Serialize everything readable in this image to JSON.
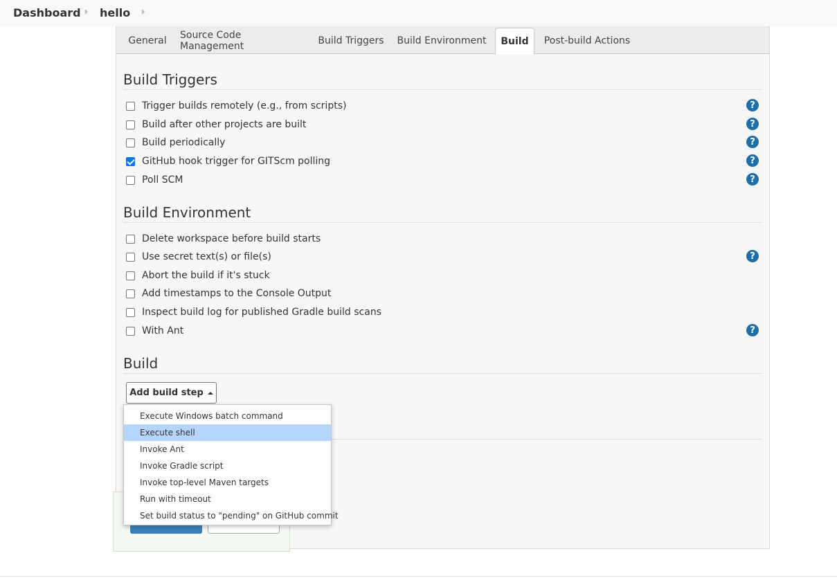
{
  "breadcrumb": {
    "items": [
      "Dashboard",
      "hello"
    ]
  },
  "tabs": [
    "General",
    "Source Code Management",
    "Build Triggers",
    "Build Environment",
    "Build",
    "Post-build Actions"
  ],
  "active_tab": "Build",
  "build_triggers": {
    "title": "Build Triggers",
    "options": [
      {
        "label": "Trigger builds remotely (e.g., from scripts)",
        "checked": false,
        "help": true
      },
      {
        "label": "Build after other projects are built",
        "checked": false,
        "help": true
      },
      {
        "label": "Build periodically",
        "checked": false,
        "help": true
      },
      {
        "label": "GitHub hook trigger for GITScm polling",
        "checked": true,
        "help": true
      },
      {
        "label": "Poll SCM",
        "checked": false,
        "help": true
      }
    ]
  },
  "build_environment": {
    "title": "Build Environment",
    "options": [
      {
        "label": "Delete workspace before build starts",
        "checked": false,
        "help": false
      },
      {
        "label": "Use secret text(s) or file(s)",
        "checked": false,
        "help": true
      },
      {
        "label": "Abort the build if it's stuck",
        "checked": false,
        "help": false
      },
      {
        "label": "Add timestamps to the Console Output",
        "checked": false,
        "help": false
      },
      {
        "label": "Inspect build log for published Gradle build scans",
        "checked": false,
        "help": false
      },
      {
        "label": "With Ant",
        "checked": false,
        "help": true
      }
    ]
  },
  "build": {
    "title": "Build",
    "add_step_label": "Add build step"
  },
  "help_glyph": "?",
  "menu": {
    "items": [
      "Execute Windows batch command",
      "Execute shell",
      "Invoke Ant",
      "Invoke Gradle script",
      "Invoke top-level Maven targets",
      "Run with timeout",
      "Set build status to \"pending\" on GitHub commit"
    ],
    "highlighted": "Execute shell"
  },
  "colors": {
    "accent": "#1f6ea8",
    "highlight": "#b5d5fd",
    "checkbox_checked": "#0075ff"
  }
}
